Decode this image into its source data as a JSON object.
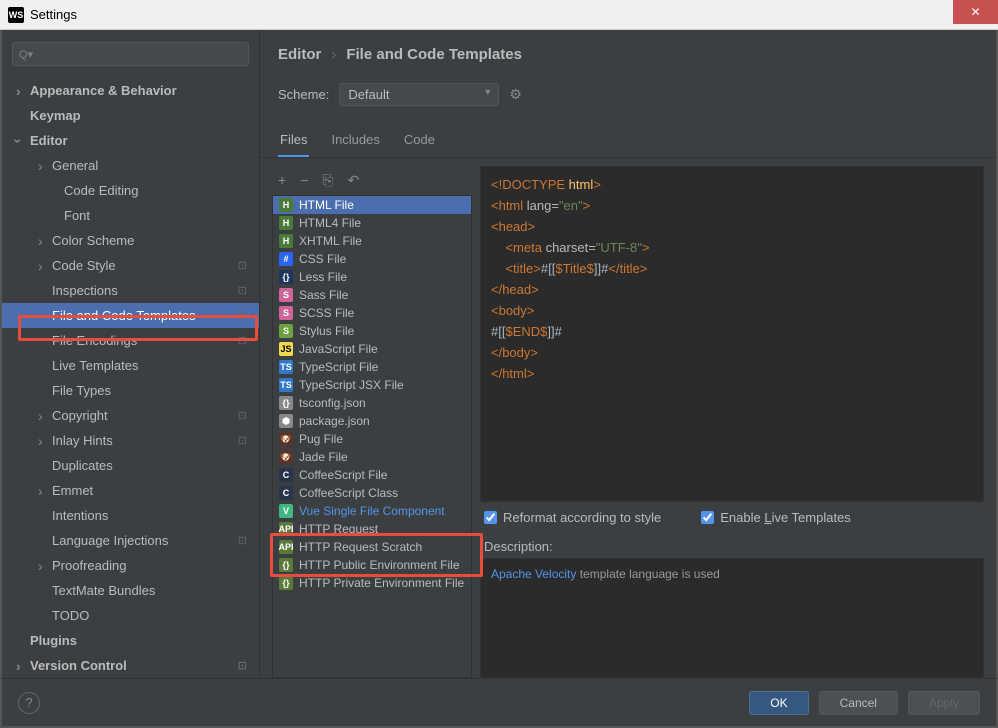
{
  "window": {
    "title": "Settings",
    "icon": "WS"
  },
  "breadcrumb": {
    "part1": "Editor",
    "part2": "File and Code Templates"
  },
  "scheme": {
    "label": "Scheme:",
    "value": "Default"
  },
  "tabs": [
    {
      "label": "Files",
      "active": true
    },
    {
      "label": "Includes",
      "active": false
    },
    {
      "label": "Code",
      "active": false
    }
  ],
  "toolbar": {
    "add": "+",
    "remove": "−",
    "copy": "⎘",
    "undo": "↶"
  },
  "sidebar": {
    "items": [
      {
        "label": "Appearance & Behavior",
        "level": 1,
        "exp": true
      },
      {
        "label": "Keymap",
        "level": 1
      },
      {
        "label": "Editor",
        "level": 1,
        "exp": true,
        "expanded": true
      },
      {
        "label": "General",
        "level": 2,
        "exp": true
      },
      {
        "label": "Code Editing",
        "level": 3
      },
      {
        "label": "Font",
        "level": 3
      },
      {
        "label": "Color Scheme",
        "level": 2,
        "exp": true
      },
      {
        "label": "Code Style",
        "level": 2,
        "exp": true,
        "badge": "⊡"
      },
      {
        "label": "Inspections",
        "level": 2,
        "badge": "⊡"
      },
      {
        "label": "File and Code Templates",
        "level": 2,
        "selected": true,
        "badge": "⊡"
      },
      {
        "label": "File Encodings",
        "level": 2,
        "badge": "⊡"
      },
      {
        "label": "Live Templates",
        "level": 2
      },
      {
        "label": "File Types",
        "level": 2
      },
      {
        "label": "Copyright",
        "level": 2,
        "exp": true,
        "badge": "⊡"
      },
      {
        "label": "Inlay Hints",
        "level": 2,
        "exp": true,
        "badge": "⊡"
      },
      {
        "label": "Duplicates",
        "level": 2
      },
      {
        "label": "Emmet",
        "level": 2,
        "exp": true
      },
      {
        "label": "Intentions",
        "level": 2
      },
      {
        "label": "Language Injections",
        "level": 2,
        "badge": "⊡"
      },
      {
        "label": "Proofreading",
        "level": 2,
        "exp": true
      },
      {
        "label": "TextMate Bundles",
        "level": 2
      },
      {
        "label": "TODO",
        "level": 2
      },
      {
        "label": "Plugins",
        "level": 1
      },
      {
        "label": "Version Control",
        "level": 1,
        "exp": true,
        "badge": "⊡"
      }
    ]
  },
  "files": [
    {
      "label": "HTML File",
      "icon": "ic-html",
      "ic": "H",
      "selected": true
    },
    {
      "label": "HTML4 File",
      "icon": "ic-html",
      "ic": "H"
    },
    {
      "label": "XHTML File",
      "icon": "ic-html",
      "ic": "H"
    },
    {
      "label": "CSS File",
      "icon": "ic-css",
      "ic": "#"
    },
    {
      "label": "Less File",
      "icon": "ic-less",
      "ic": "{}"
    },
    {
      "label": "Sass File",
      "icon": "ic-sass",
      "ic": "S"
    },
    {
      "label": "SCSS File",
      "icon": "ic-sass",
      "ic": "S"
    },
    {
      "label": "Stylus File",
      "icon": "ic-styl",
      "ic": "S"
    },
    {
      "label": "JavaScript File",
      "icon": "ic-js",
      "ic": "JS"
    },
    {
      "label": "TypeScript File",
      "icon": "ic-ts",
      "ic": "TS"
    },
    {
      "label": "TypeScript JSX File",
      "icon": "ic-ts",
      "ic": "TS"
    },
    {
      "label": "tsconfig.json",
      "icon": "ic-json",
      "ic": "{}"
    },
    {
      "label": "package.json",
      "icon": "ic-json",
      "ic": "⬢"
    },
    {
      "label": "Pug File",
      "icon": "ic-pug",
      "ic": "🐶"
    },
    {
      "label": "Jade File",
      "icon": "ic-pug",
      "ic": "🐶"
    },
    {
      "label": "CoffeeScript File",
      "icon": "ic-coffee",
      "ic": "C"
    },
    {
      "label": "CoffeeScript Class",
      "icon": "ic-coffee",
      "ic": "C"
    },
    {
      "label": "Vue Single File Component",
      "icon": "ic-vue",
      "ic": "V",
      "vue": true
    },
    {
      "label": "HTTP Request",
      "icon": "ic-http",
      "ic": "API"
    },
    {
      "label": "HTTP Request Scratch",
      "icon": "ic-http",
      "ic": "API"
    },
    {
      "label": "HTTP Public Environment File",
      "icon": "ic-http",
      "ic": "{}"
    },
    {
      "label": "HTTP Private Environment File",
      "icon": "ic-http",
      "ic": "{}"
    }
  ],
  "code": {
    "l1a": "<!DOCTYPE",
    "l1b": " html",
    "l1c": ">",
    "l2a": "<html ",
    "l2b": "lang=",
    "l2c": "\"en\"",
    "l2d": ">",
    "l3": "<head>",
    "l4a": "    <meta ",
    "l4b": "charset=",
    "l4c": "\"UTF-8\"",
    "l4d": ">",
    "l5a": "    <title>",
    "l5b": "#[[",
    "l5c": "$Title$",
    "l5d": "]]#",
    "l5e": "</title>",
    "l6": "</head>",
    "l7": "<body>",
    "l8a": "#[[",
    "l8b": "$END$",
    "l8c": "]]#",
    "l9": "</body>",
    "l10": "</html>"
  },
  "checkboxes": {
    "reformat": "Reformat according to style",
    "live": "Enable Live Templates",
    "live_u": "L"
  },
  "description": {
    "label": "Description:",
    "link": "Apache Velocity",
    "text": " template language is used"
  },
  "footer": {
    "ok": "OK",
    "cancel": "Cancel",
    "apply": "Apply"
  }
}
